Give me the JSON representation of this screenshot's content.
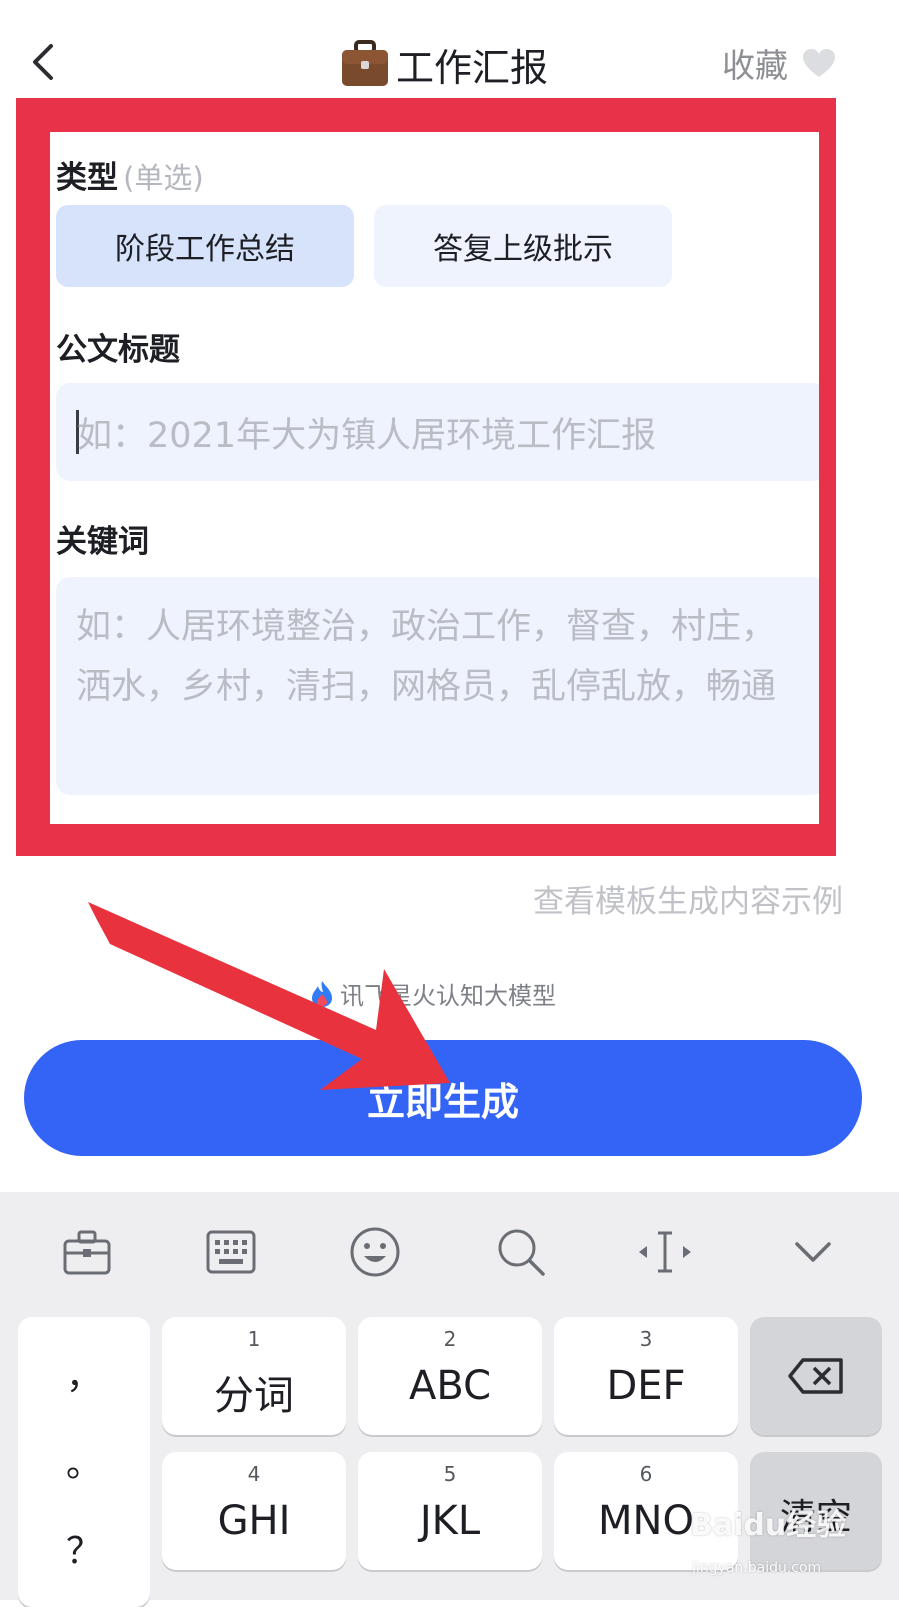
{
  "header": {
    "back_icon": "chevron-left-icon",
    "title_emoji": "💼",
    "title": "工作汇报",
    "favorite_label": "收藏",
    "favorite_icon": "heart-icon"
  },
  "form": {
    "type_label": "类型",
    "type_hint": "(单选)",
    "type_options": [
      {
        "label": "阶段工作总结",
        "selected": true
      },
      {
        "label": "答复上级批示",
        "selected": false
      }
    ],
    "title_label": "公文标题",
    "title_placeholder": "如：2021年大为镇人居环境工作汇报",
    "keywords_label": "关键词",
    "keywords_placeholder": "如：人居环境整治，政治工作，督查，村庄，洒水，乡村，清扫，网格员，乱停乱放，畅通"
  },
  "example_link": "查看模板生成内容示例",
  "brand": "讯飞星火认知大模型",
  "generate_button": "立即生成",
  "keyboard": {
    "toolbar_icons": [
      "toolbox-icon",
      "keyboard-icon",
      "emoji-icon",
      "search-icon",
      "cursor-move-icon",
      "collapse-icon"
    ],
    "punctuation": [
      "，",
      "。",
      "？"
    ],
    "keys": [
      {
        "num": "1",
        "label": "分词"
      },
      {
        "num": "2",
        "label": "ABC"
      },
      {
        "num": "3",
        "label": "DEF"
      },
      {
        "num": "4",
        "label": "GHI"
      },
      {
        "num": "5",
        "label": "JKL"
      },
      {
        "num": "6",
        "label": "MNO"
      }
    ],
    "clear_label": "清空",
    "backspace_icon": "backspace-icon"
  },
  "watermark": {
    "brand": "Baidu经验",
    "url": "jingyan.baidu.com"
  },
  "colors": {
    "accent": "#3464f5",
    "annotation_red": "#e83249",
    "selected_chip": "#d6e3fb",
    "field_bg": "#eef3fd"
  }
}
